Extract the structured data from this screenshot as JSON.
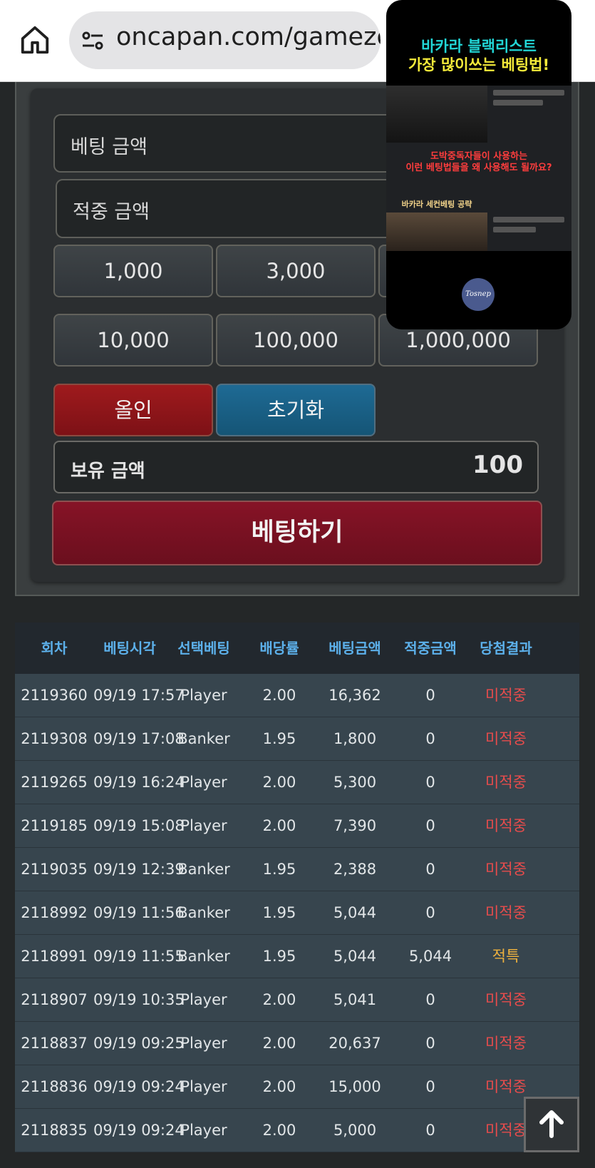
{
  "browser": {
    "url": "oncapan.com/gamezo"
  },
  "bet_form": {
    "bet_amount_placeholder": "베팅 금액",
    "win_amount_placeholder": "적중 금액",
    "chips": [
      "1,000",
      "3,000",
      "10,000",
      "100,000",
      "1,000,000"
    ],
    "allin_label": "올인",
    "reset_label": "초기화",
    "balance_label": "보유 금액",
    "balance_value": "100",
    "submit_label": "베팅하기"
  },
  "history": {
    "columns": [
      "회차",
      "베팅시각",
      "선택베팅",
      "배당률",
      "베팅금액",
      "적중금액",
      "당첨결과"
    ],
    "rows": [
      {
        "round": "2119360",
        "time": "09/19 17:57",
        "pick": "Player",
        "odds": "2.00",
        "bet": "16,362",
        "win": "0",
        "result": "미적중",
        "status": "lose"
      },
      {
        "round": "2119308",
        "time": "09/19 17:08",
        "pick": "Banker",
        "odds": "1.95",
        "bet": "1,800",
        "win": "0",
        "result": "미적중",
        "status": "lose"
      },
      {
        "round": "2119265",
        "time": "09/19 16:24",
        "pick": "Player",
        "odds": "2.00",
        "bet": "5,300",
        "win": "0",
        "result": "미적중",
        "status": "lose"
      },
      {
        "round": "2119185",
        "time": "09/19 15:08",
        "pick": "Player",
        "odds": "2.00",
        "bet": "7,390",
        "win": "0",
        "result": "미적중",
        "status": "lose"
      },
      {
        "round": "2119035",
        "time": "09/19 12:39",
        "pick": "Banker",
        "odds": "1.95",
        "bet": "2,388",
        "win": "0",
        "result": "미적중",
        "status": "lose"
      },
      {
        "round": "2118992",
        "time": "09/19 11:56",
        "pick": "Banker",
        "odds": "1.95",
        "bet": "5,044",
        "win": "0",
        "result": "미적중",
        "status": "lose"
      },
      {
        "round": "2118991",
        "time": "09/19 11:55",
        "pick": "Banker",
        "odds": "1.95",
        "bet": "5,044",
        "win": "5,044",
        "result": "적특",
        "status": "win"
      },
      {
        "round": "2118907",
        "time": "09/19 10:35",
        "pick": "Player",
        "odds": "2.00",
        "bet": "5,041",
        "win": "0",
        "result": "미적중",
        "status": "lose"
      },
      {
        "round": "2118837",
        "time": "09/19 09:25",
        "pick": "Player",
        "odds": "2.00",
        "bet": "20,637",
        "win": "0",
        "result": "미적중",
        "status": "lose"
      },
      {
        "round": "2118836",
        "time": "09/19 09:24",
        "pick": "Player",
        "odds": "2.00",
        "bet": "15,000",
        "win": "0",
        "result": "미적중",
        "status": "lose"
      },
      {
        "round": "2118835",
        "time": "09/19 09:24",
        "pick": "Player",
        "odds": "2.00",
        "bet": "5,000",
        "win": "0",
        "result": "미적중",
        "status": "lose"
      }
    ]
  },
  "video_overlay": {
    "title_line1": "바카라 블랙리스트",
    "title_line2": "가장 많이쓰는 베팅법!",
    "caption_red_line1": "도박중독자들이 사용하는",
    "caption_red_line2": "이런 베팅법들을 왜 사용해도 될까요?",
    "caption_gold": "바카라 세컨베팅 공략",
    "channel_logo": "Tosnep"
  },
  "icons": {
    "home": "home-icon",
    "site_info": "tune-icon",
    "scroll_top": "arrow-up-icon"
  },
  "colors": {
    "lose": "#e84c4c",
    "win": "#efb23e",
    "header_text": "#5cb0ea",
    "submit": "#861326",
    "allin": "#9f1a1d",
    "reset": "#1e6a94"
  }
}
